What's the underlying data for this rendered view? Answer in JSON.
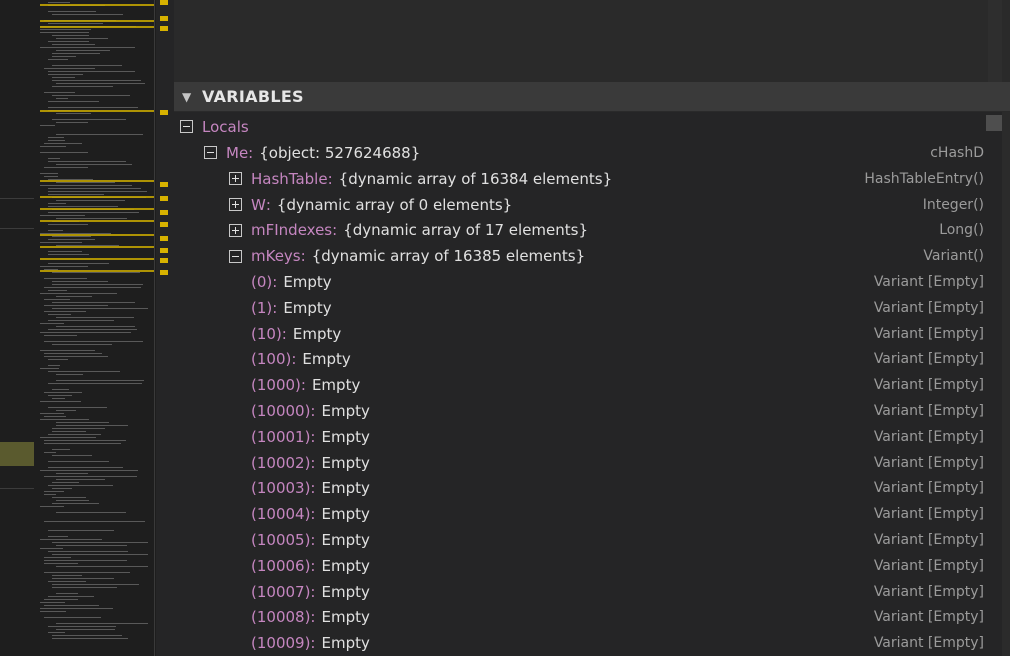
{
  "variables": {
    "title": "VARIABLES",
    "section_label": "Locals",
    "me": {
      "name": "Me",
      "value": "{object: 527624688}",
      "type": "cHashD"
    },
    "members": [
      {
        "name": "HashTable",
        "value": "{dynamic array of 16384 elements}",
        "type": "HashTableEntry()",
        "expanded": false
      },
      {
        "name": "W",
        "value": "{dynamic array of 0 elements}",
        "type": "Integer()",
        "expanded": false
      },
      {
        "name": "mFIndexes",
        "value": "{dynamic array of 17 elements}",
        "type": "Long()",
        "expanded": false
      },
      {
        "name": "mKeys",
        "value": "{dynamic array of 16385 elements}",
        "type": "Variant()",
        "expanded": true
      }
    ],
    "keys": [
      {
        "name": "(0)",
        "value": "Empty",
        "type": "Variant [Empty]"
      },
      {
        "name": "(1)",
        "value": "Empty",
        "type": "Variant [Empty]"
      },
      {
        "name": "(10)",
        "value": "Empty",
        "type": "Variant [Empty]"
      },
      {
        "name": "(100)",
        "value": "Empty",
        "type": "Variant [Empty]"
      },
      {
        "name": "(1000)",
        "value": "Empty",
        "type": "Variant [Empty]"
      },
      {
        "name": "(10000)",
        "value": "Empty",
        "type": "Variant [Empty]"
      },
      {
        "name": "(10001)",
        "value": "Empty",
        "type": "Variant [Empty]"
      },
      {
        "name": "(10002)",
        "value": "Empty",
        "type": "Variant [Empty]"
      },
      {
        "name": "(10003)",
        "value": "Empty",
        "type": "Variant [Empty]"
      },
      {
        "name": "(10004)",
        "value": "Empty",
        "type": "Variant [Empty]"
      },
      {
        "name": "(10005)",
        "value": "Empty",
        "type": "Variant [Empty]"
      },
      {
        "name": "(10006)",
        "value": "Empty",
        "type": "Variant [Empty]"
      },
      {
        "name": "(10007)",
        "value": "Empty",
        "type": "Variant [Empty]"
      },
      {
        "name": "(10008)",
        "value": "Empty",
        "type": "Variant [Empty]"
      },
      {
        "name": "(10009)",
        "value": "Empty",
        "type": "Variant [Empty]"
      }
    ]
  },
  "colors": {
    "name": "#c586c0",
    "value": "#e0e0e0",
    "type": "#9b9b9b",
    "header_bg": "#3a3a3a",
    "panel_bg": "#252526",
    "minimap_highlight": "#d7b200"
  },
  "icons": {
    "collapse": "minus-box-icon",
    "expand": "plus-box-icon",
    "header_chevron": "chevron-down-icon"
  }
}
